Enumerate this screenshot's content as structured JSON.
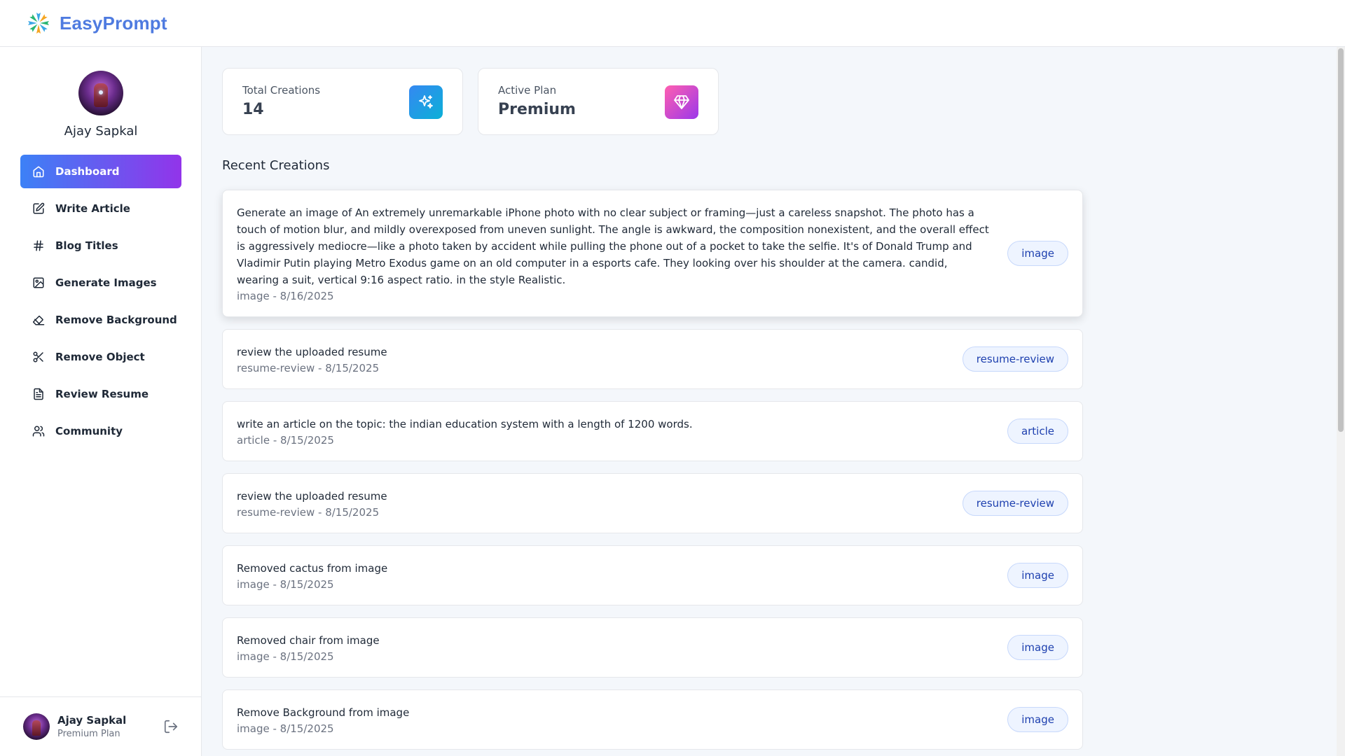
{
  "app": {
    "name": "EasyPrompt"
  },
  "user": {
    "name": "Ajay Sapkal",
    "plan_label": "Premium Plan"
  },
  "sidebar": {
    "items": [
      {
        "label": "Dashboard",
        "icon": "home-icon",
        "active": true
      },
      {
        "label": "Write Article",
        "icon": "edit-icon"
      },
      {
        "label": "Blog Titles",
        "icon": "hash-icon"
      },
      {
        "label": "Generate Images",
        "icon": "image-icon"
      },
      {
        "label": "Remove Background",
        "icon": "eraser-icon"
      },
      {
        "label": "Remove Object",
        "icon": "scissors-icon"
      },
      {
        "label": "Review Resume",
        "icon": "file-text-icon"
      },
      {
        "label": "Community",
        "icon": "users-icon"
      }
    ]
  },
  "stats": {
    "total_creations": {
      "label": "Total Creations",
      "value": "14",
      "color": "#3b8bd9"
    },
    "active_plan": {
      "label": "Active Plan",
      "value": "Premium",
      "color": "#d946ef"
    }
  },
  "recent": {
    "title": "Recent Creations",
    "items": [
      {
        "prompt": "Generate an image of An extremely unremarkable iPhone photo with no clear subject or framing—just a careless snapshot. The photo has a touch of motion blur, and mildly overexposed from uneven sunlight. The angle is awkward, the composition nonexistent, and the overall effect is aggressively mediocre—like a photo taken by accident while pulling the phone out of a pocket to take the selfie. It's of Donald Trump and Vladimir Putin playing Metro Exodus game on an old computer in a esports cafe. They looking over his shoulder at the camera. candid, wearing a suit, vertical 9:16 aspect ratio. in the style Realistic.",
        "meta": "image - 8/16/2025",
        "tag": "image"
      },
      {
        "prompt": "review the uploaded resume",
        "meta": "resume-review - 8/15/2025",
        "tag": "resume-review"
      },
      {
        "prompt": "write an article on the topic: the indian education system with a length of 1200 words.",
        "meta": "article - 8/15/2025",
        "tag": "article"
      },
      {
        "prompt": "review the uploaded resume",
        "meta": "resume-review - 8/15/2025",
        "tag": "resume-review"
      },
      {
        "prompt": "Removed cactus from image",
        "meta": "image - 8/15/2025",
        "tag": "image"
      },
      {
        "prompt": "Removed chair from image",
        "meta": "image - 8/15/2025",
        "tag": "image"
      },
      {
        "prompt": "Remove Background from image",
        "meta": "image - 8/15/2025",
        "tag": "image"
      }
    ]
  },
  "colors": {
    "accent_start": "#3c81f6",
    "accent_end": "#9234ea",
    "brand": "#4f7be0"
  }
}
